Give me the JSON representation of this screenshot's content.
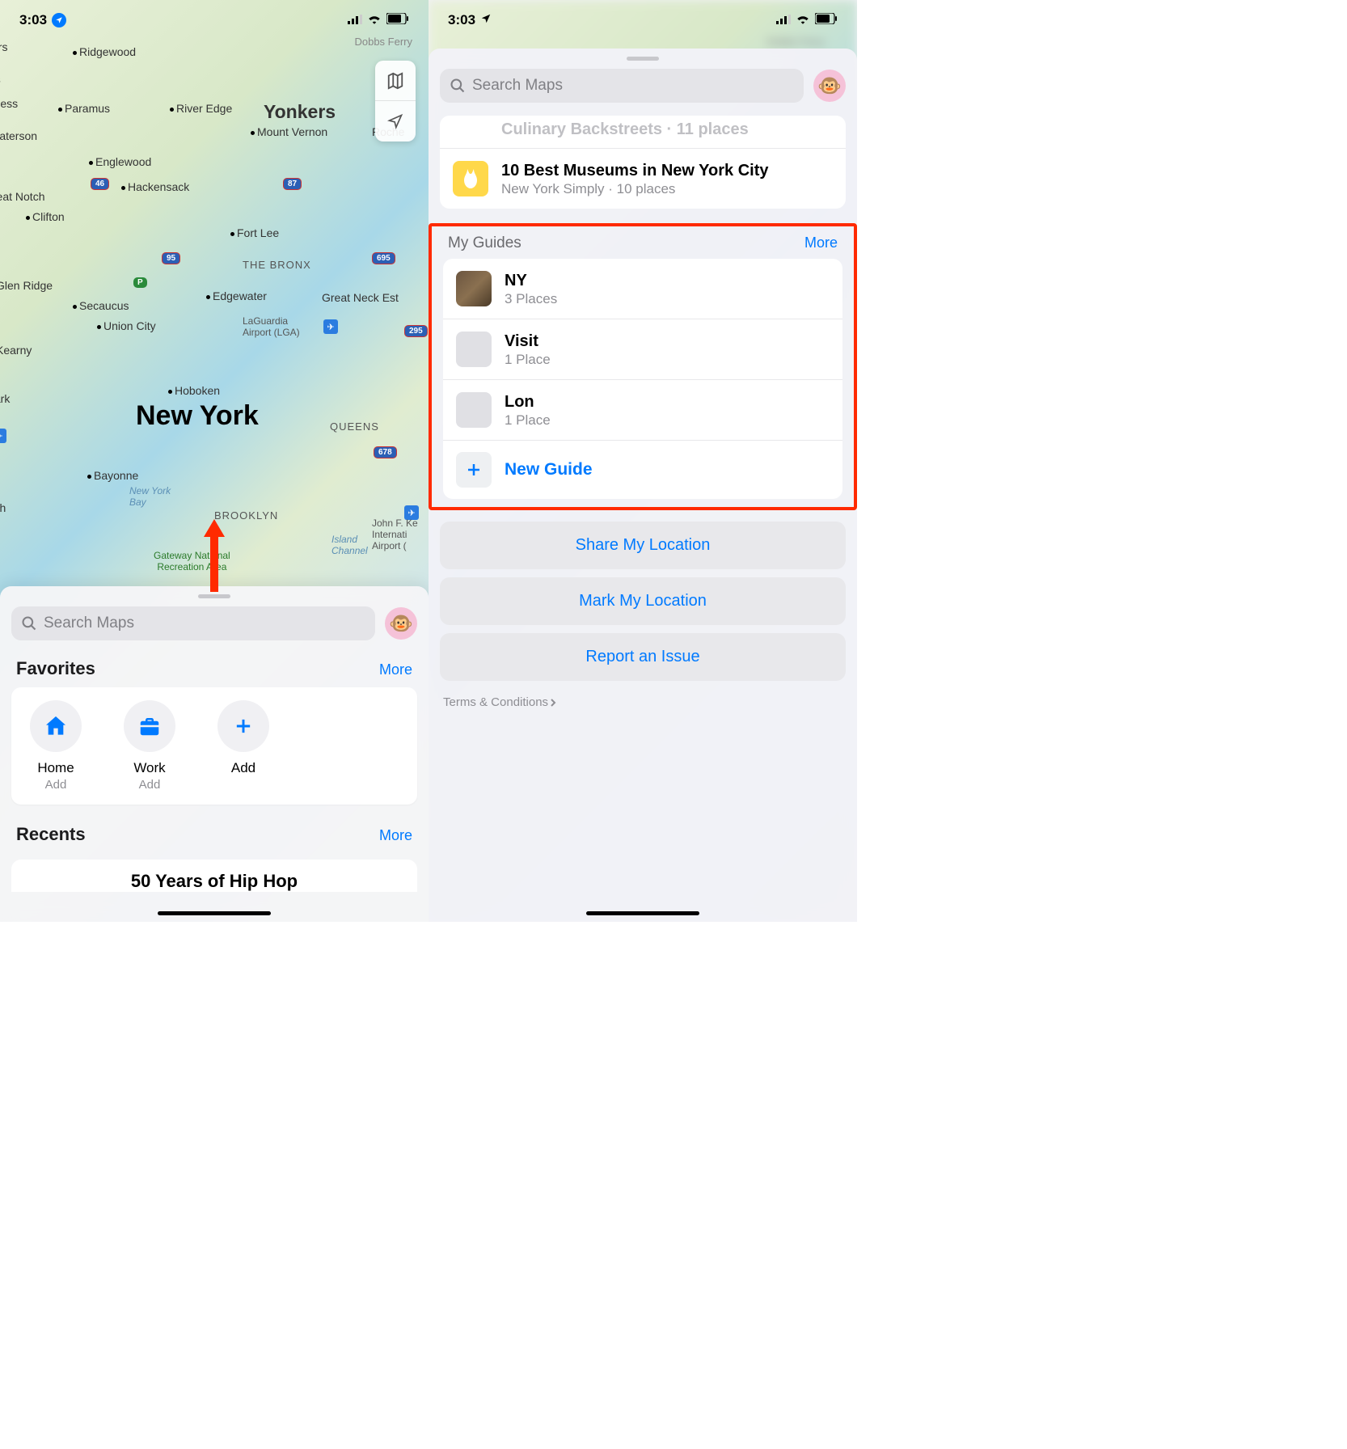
{
  "status": {
    "time": "3:03"
  },
  "search": {
    "placeholder": "Search Maps"
  },
  "map": {
    "major_city": "New York",
    "big_city": "Yonkers",
    "boroughs": {
      "bronx": "THE BRONX",
      "queens": "QUEENS",
      "brooklyn": "BROOKLYN"
    },
    "cities": {
      "ridgewood": "Ridgewood",
      "paramus": "Paramus",
      "river_edge": "River Edge",
      "mount_vernon": "Mount Vernon",
      "roche": "Roche",
      "paterson": "Paterson",
      "englewood": "Englewood",
      "hackensack": "Hackensack",
      "great_notch": "Great Notch",
      "clifton": "Clifton",
      "fort_lee": "Fort Lee",
      "glen_ridge": "Glen Ridge",
      "secaucus": "Secaucus",
      "edgewater": "Edgewater",
      "great_neck": "Great Neck Est",
      "union_city": "Union City",
      "kearny": "Kearny",
      "hoboken": "Hoboken",
      "newark": "ewark",
      "bayonne": "Bayonne",
      "eakness": "eakness",
      "beth": "beth",
      "lains": "lains",
      "ers": "ers",
      "dobbs": "Dobbs Ferry"
    },
    "airports": {
      "lga": "LaGuardia\nAirport (LGA)",
      "jfk": "John F. Ke\nInternati\nAirport ("
    },
    "water": {
      "nybay": "New York\nBay",
      "island_channel": "Island\nChannel"
    },
    "park": "Gateway National\nRecreation Area",
    "routes": {
      "r46": "46",
      "r87": "87",
      "r95": "95",
      "r695": "695",
      "r295": "295",
      "r678": "678"
    }
  },
  "left": {
    "favorites": {
      "title": "Favorites",
      "more": "More",
      "items": [
        {
          "name": "Home",
          "sub": "Add"
        },
        {
          "name": "Work",
          "sub": "Add"
        },
        {
          "name": "Add",
          "sub": ""
        }
      ]
    },
    "recents": {
      "title": "Recents",
      "more": "More",
      "item": "50 Years of Hip Hop"
    }
  },
  "right": {
    "curated_peek": {
      "sub": "Culinary Backstreets · 11 places"
    },
    "curated": {
      "title": "10 Best Museums in New York City",
      "sub": "New York Simply · 10 places"
    },
    "my_guides": {
      "title": "My Guides",
      "more": "More",
      "items": [
        {
          "name": "NY",
          "sub": "3 Places"
        },
        {
          "name": "Visit",
          "sub": "1 Place"
        },
        {
          "name": "Lon",
          "sub": "1 Place"
        }
      ],
      "new": "New Guide"
    },
    "actions": {
      "share": "Share My Location",
      "mark": "Mark My Location",
      "report": "Report an Issue"
    },
    "terms": "Terms & Conditions"
  }
}
